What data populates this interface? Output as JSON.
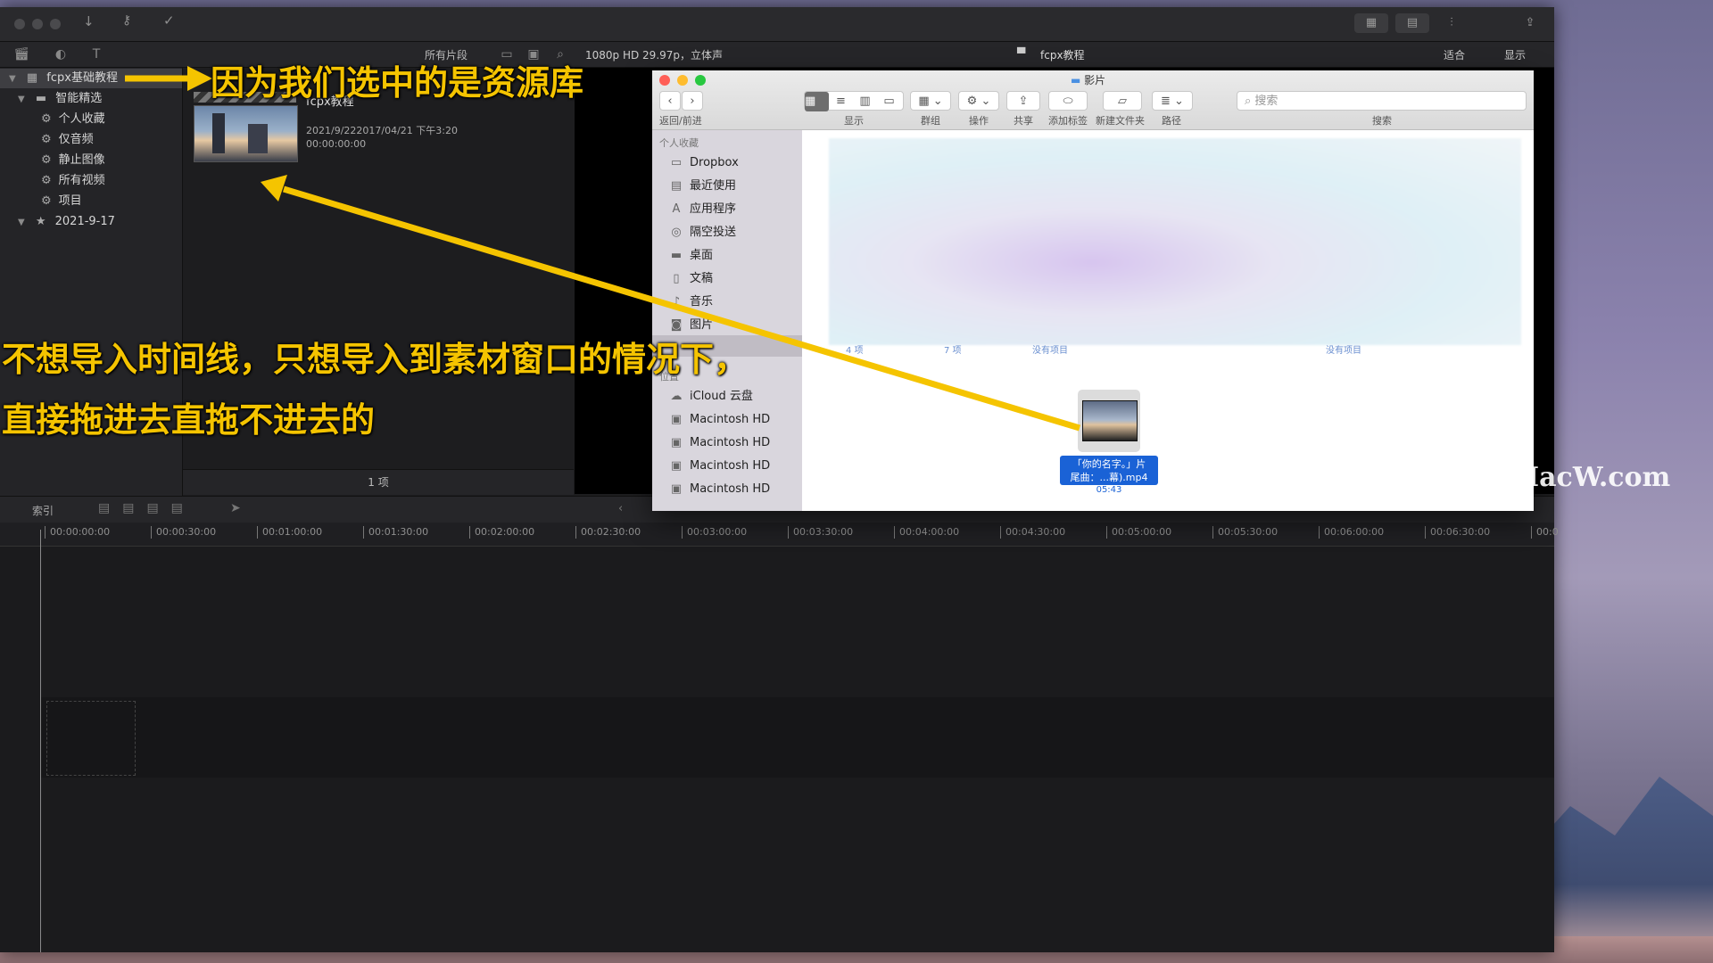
{
  "fcp": {
    "toolbar_dropdown": "所有片段",
    "format_info": "1080p HD 29.97p，立体声",
    "project_name": "fcpx教程",
    "fit_label": "适合",
    "display_label": "显示",
    "sidebar": {
      "library": "fcpx基础教程",
      "smart_collections": "智能精选",
      "items": [
        "个人收藏",
        "仅音频",
        "静止图像",
        "所有视频",
        "项目"
      ],
      "event": "2021-9-17"
    },
    "browser": {
      "clip_title": "fcpx教程",
      "clip_date": "2021/9/222017/04/21 下午3:20",
      "clip_timecode": "00:00:00:00",
      "count": "1 项"
    },
    "timeline": {
      "index_label": "索引",
      "ruler": [
        "00:00:00:00",
        "00:00:30:00",
        "00:01:00:00",
        "00:01:30:00",
        "00:02:00:00",
        "00:02:30:00",
        "00:03:00:00",
        "00:03:30:00",
        "00:04:00:00",
        "00:04:30:00",
        "00:05:00:00",
        "00:05:30:00",
        "00:06:00:00",
        "00:06:30:00",
        "00:0"
      ]
    }
  },
  "finder": {
    "title": "影片",
    "nav_label": "返回/前进",
    "labels": {
      "view": "显示",
      "group": "群组",
      "action": "操作",
      "share": "共享",
      "tag": "添加标签",
      "new_folder": "新建文件夹",
      "path": "路径",
      "search": "搜索"
    },
    "search_placeholder": "搜索",
    "favorites_header": "个人收藏",
    "favorites": [
      "Dropbox",
      "最近使用",
      "应用程序",
      "隔空投送",
      "桌面",
      "文稿",
      "音乐",
      "图片"
    ],
    "locations_header": "位置",
    "locations": [
      "iCloud 云盘",
      "Macintosh HD",
      "Macintosh HD",
      "Macintosh HD",
      "Macintosh HD"
    ],
    "faint_counts": [
      "4 项",
      "7 项",
      "没有项目",
      "没有项目"
    ],
    "file": {
      "name_line1": "「你的名字。」片",
      "name_line2": "尾曲：...幕).mp4",
      "duration": "05:43"
    }
  },
  "annotations": {
    "top": "因为我们选中的是资源库",
    "line1": "不想导入时间线，只想导入到素材窗口的情况下，",
    "line2": "直接拖进去直拖不进去的",
    "color": "#f5c400"
  },
  "watermark": "www.MacW.com"
}
